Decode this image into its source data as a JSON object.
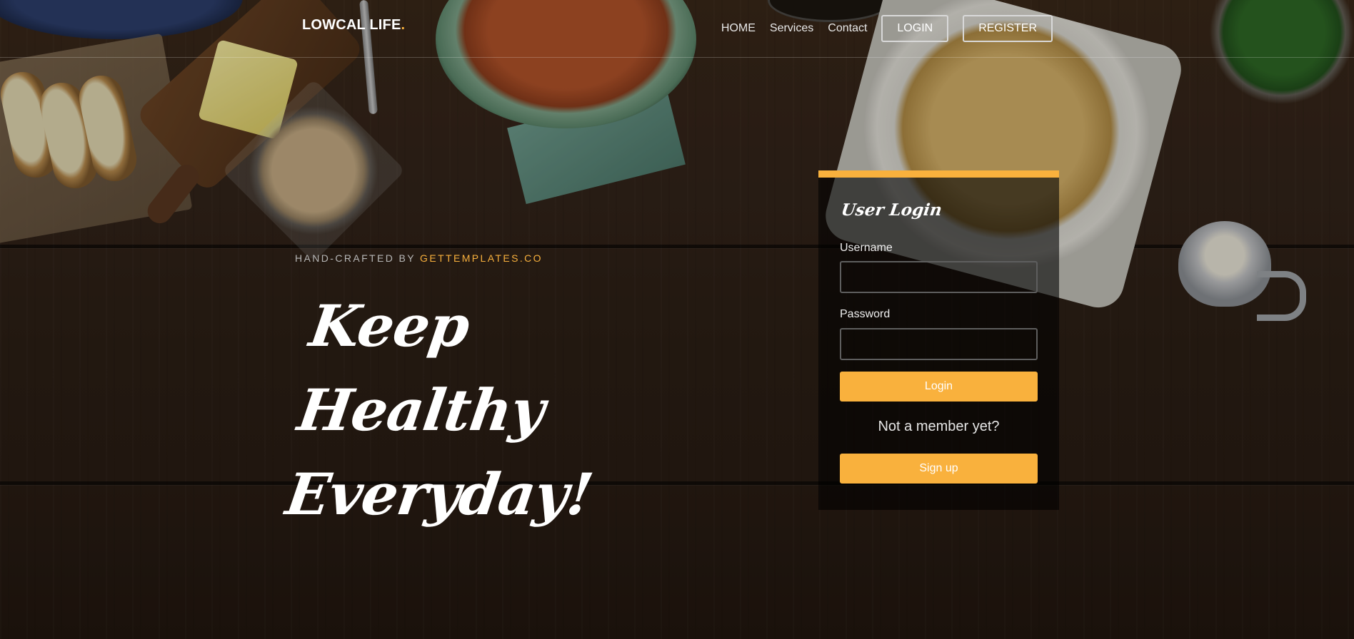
{
  "header": {
    "logo_text": "LOWCAL LIFE",
    "logo_dot": ".",
    "nav": {
      "home": "HOME",
      "services": "Services",
      "contact": "Contact",
      "login": "LOGIN",
      "register": "REGISTER"
    }
  },
  "hero": {
    "tagline_prefix": "HAND-CRAFTED BY ",
    "tagline_link": "GETTEMPLATES.CO",
    "headline_line1": "Keep Healthy",
    "headline_line2": "Everyday!"
  },
  "login_card": {
    "title": "User Login",
    "username_label": "Username",
    "username_value": "",
    "password_label": "Password",
    "password_value": "",
    "login_button": "Login",
    "not_member_text": "Not a member yet?",
    "signup_button": "Sign up"
  },
  "colors": {
    "accent": "#f9b13d",
    "card_background": "rgba(0,0,0,0.58)",
    "text": "#ffffff"
  }
}
